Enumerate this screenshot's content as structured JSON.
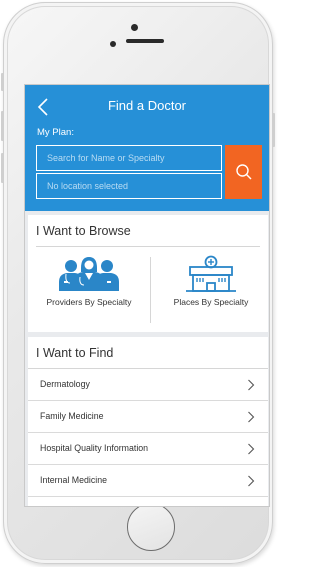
{
  "header": {
    "title": "Find a Doctor",
    "plan_label": "My Plan:",
    "search_placeholder": "Search for Name or Specialty",
    "location_placeholder": "No location selected"
  },
  "browse": {
    "title": "I Want to Browse",
    "items": [
      {
        "label": "Providers By Specialty",
        "icon": "doctors-group-icon"
      },
      {
        "label": "Places By Specialty",
        "icon": "hospital-building-icon"
      }
    ]
  },
  "find": {
    "title": "I Want to Find",
    "items": [
      {
        "label": "Dermatology"
      },
      {
        "label": "Family Medicine"
      },
      {
        "label": "Hospital Quality Information"
      },
      {
        "label": "Internal Medicine"
      }
    ]
  },
  "colors": {
    "header_blue": "#2690d7",
    "search_orange": "#f26522",
    "icon_blue": "#2a86c8"
  }
}
